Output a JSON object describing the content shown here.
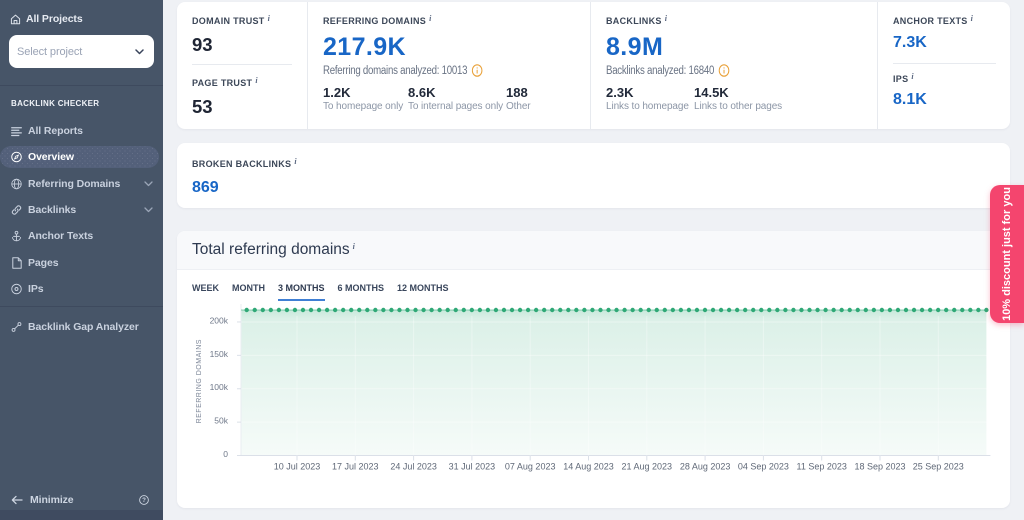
{
  "sidebar": {
    "all_projects_label": "All Projects",
    "select_project": {
      "placeholder": "Select project"
    },
    "section_label": "BACKLINK CHECKER",
    "items": [
      {
        "label": "All Reports",
        "icon": "reports-list-icon",
        "active": false,
        "expandable": false
      },
      {
        "label": "Overview",
        "icon": "compass-icon",
        "active": true,
        "expandable": false
      },
      {
        "label": "Referring Domains",
        "icon": "globe-icon",
        "active": false,
        "expandable": true
      },
      {
        "label": "Backlinks",
        "icon": "link-icon",
        "active": false,
        "expandable": true
      },
      {
        "label": "Anchor Texts",
        "icon": "anchor-icon",
        "active": false,
        "expandable": false
      },
      {
        "label": "Pages",
        "icon": "page-icon",
        "active": false,
        "expandable": false
      },
      {
        "label": "IPs",
        "icon": "target-icon",
        "active": false,
        "expandable": false
      }
    ],
    "tools": [
      {
        "label": "Backlink Gap Analyzer",
        "icon": "gap-analyzer-icon"
      }
    ],
    "minimize_label": "Minimize"
  },
  "stats_card": {
    "domain_trust": {
      "label": "DOMAIN TRUST",
      "value": "93"
    },
    "page_trust": {
      "label": "PAGE TRUST",
      "value": "53"
    },
    "referring_domains": {
      "label": "REFERRING DOMAINS",
      "value": "217.9K",
      "analyzed": "Referring domains analyzed: 10013",
      "breakdown": [
        {
          "value": "1.2K",
          "caption": "To homepage only"
        },
        {
          "value": "8.6K",
          "caption": "To internal pages only"
        },
        {
          "value": "188",
          "caption": "Other"
        }
      ]
    },
    "backlinks": {
      "label": "BACKLINKS",
      "value": "8.9M",
      "analyzed": "Backlinks analyzed: 16840",
      "breakdown": [
        {
          "value": "2.3K",
          "caption": "Links to homepage"
        },
        {
          "value": "14.5K",
          "caption": "Links to other pages"
        }
      ]
    },
    "anchor_texts": {
      "label": "ANCHOR TEXTS",
      "value": "7.3K"
    },
    "ips": {
      "label": "IPS",
      "value": "8.1K"
    }
  },
  "broken_card": {
    "label": "BROKEN BACKLINKS",
    "value": "869"
  },
  "chart_card": {
    "title": "Total referring domains",
    "tabs": [
      {
        "label": "WEEK",
        "active": false
      },
      {
        "label": "MONTH",
        "active": false
      },
      {
        "label": "3 MONTHS",
        "active": true
      },
      {
        "label": "6 MONTHS",
        "active": false
      },
      {
        "label": "12 MONTHS",
        "active": false
      }
    ]
  },
  "chart_data": {
    "type": "area",
    "title": "Total referring domains",
    "ylabel": "REFERRING DOMAINS",
    "xlabel": "",
    "ylim": [
      0,
      230000
    ],
    "y_ticks": [
      0,
      50000,
      100000,
      150000,
      200000
    ],
    "y_tick_labels": [
      "0",
      "50k",
      "100k",
      "150k",
      "200k"
    ],
    "x_tick_labels": [
      "10 Jul 2023",
      "17 Jul 2023",
      "24 Jul 2023",
      "31 Jul 2023",
      "07 Aug 2023",
      "14 Aug 2023",
      "21 Aug 2023",
      "28 Aug 2023",
      "04 Sep 2023",
      "11 Sep 2023",
      "18 Sep 2023",
      "25 Sep 2023"
    ],
    "x_tick_day_offsets": [
      6,
      13,
      20,
      27,
      34,
      41,
      48,
      55,
      62,
      69,
      76,
      83
    ],
    "n_points": 93,
    "legend": "off",
    "grid": "off",
    "series": [
      {
        "name": "Referring domains",
        "values": [
          217900,
          217900,
          217900,
          217900,
          217900,
          217900,
          217900,
          217900,
          217900,
          217900,
          217900,
          217900,
          217900,
          217900,
          217900,
          217900,
          217900,
          217900,
          217900,
          217900,
          217900,
          217900,
          217900,
          217900,
          217900,
          217900,
          217900,
          217900,
          217900,
          217900,
          217900,
          217900,
          217900,
          217900,
          217900,
          217900,
          217900,
          217900,
          217900,
          217900,
          217900,
          217900,
          217900,
          217900,
          217900,
          217900,
          217900,
          217900,
          217900,
          217900,
          217900,
          217900,
          217900,
          217900,
          217900,
          217900,
          217900,
          217900,
          217900,
          217900,
          217900,
          217900,
          217900,
          217900,
          217900,
          217900,
          217900,
          217900,
          217900,
          217900,
          217900,
          217900,
          217900,
          217900,
          217900,
          217900,
          217900,
          217900,
          217900,
          217900,
          217900,
          217900,
          217900,
          217900,
          217900,
          217900,
          217900,
          217900,
          217900,
          217900,
          217900,
          217900,
          217900
        ]
      }
    ],
    "line_color": "#2fa876",
    "fill_color": "#2fa876"
  },
  "ribbon": {
    "text": "10% discount just for you",
    "color": "#f4456e"
  },
  "ui": {
    "hint_marker": "i",
    "help_marker": "?"
  },
  "colors": {
    "accent_blue": "#1866c6",
    "green": "#2fa876",
    "sidebar": "#475568"
  }
}
